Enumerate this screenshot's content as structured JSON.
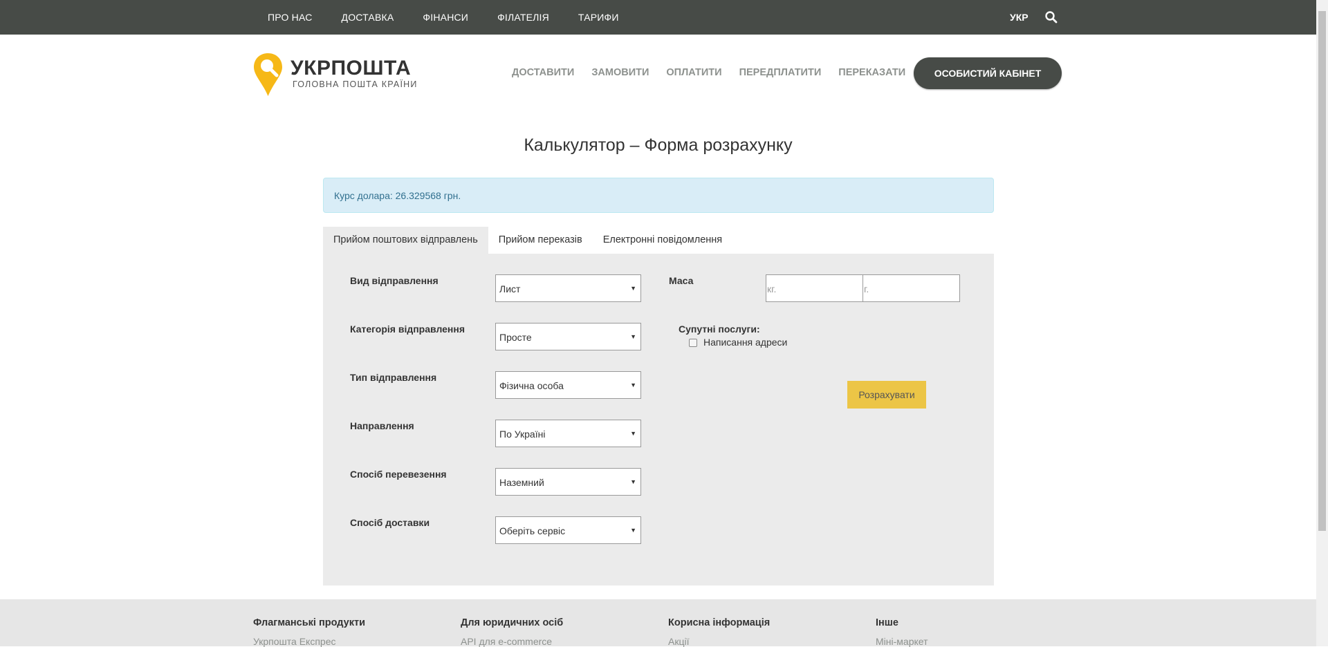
{
  "topbar": {
    "items": [
      "ПРО НАС",
      "ДОСТАВКА",
      "ФІНАНСИ",
      "ФІЛАТЕЛІЯ",
      "ТАРИФИ"
    ],
    "lang": "УКР",
    "search_icon": "search-icon"
  },
  "header": {
    "logo_name": "УКРПОШТА",
    "logo_tagline": "ГОЛОВНА ПОШТА КРАЇНИ",
    "nav": [
      "ДОСТАВИТИ",
      "ЗАМОВИТИ",
      "ОПЛАТИТИ",
      "ПЕРЕДПЛАТИТИ",
      "ПЕРЕКАЗАТИ"
    ],
    "cabinet_button": "ОСОБИСТИЙ КАБІНЕТ"
  },
  "page": {
    "title": "Калькулятор – Форма розрахунку",
    "alert": "Курс долара: 26.329568 грн."
  },
  "tabs": [
    {
      "label": "Прийом поштових відправлень",
      "active": true
    },
    {
      "label": "Прийом переказів",
      "active": false
    },
    {
      "label": "Електронні повідомлення",
      "active": false
    }
  ],
  "form": {
    "fields": [
      {
        "label": "Вид відправлення",
        "value": "Лист"
      },
      {
        "label": "Категорія відправлення",
        "value": "Просте"
      },
      {
        "label": "Тип відправлення",
        "value": "Фізична особа"
      },
      {
        "label": "Направлення",
        "value": "По Україні"
      },
      {
        "label": "Спосіб перевезення",
        "value": "Наземний"
      },
      {
        "label": "Спосіб доставки",
        "value": "Оберіть сервіс"
      }
    ],
    "mass_label": "Маса",
    "kg_placeholder": "кг.",
    "g_placeholder": "г.",
    "services_label": "Супутні послуги:",
    "service_option": "Написання адреси",
    "calculate_button": "Розрахувати"
  },
  "footer": {
    "columns": [
      {
        "title": "Флагманські продукти",
        "link": "Укрпошта Експрес"
      },
      {
        "title": "Для юридичних осіб",
        "link": "API для e-commerce"
      },
      {
        "title": "Корисна інформація",
        "link": "Акції"
      },
      {
        "title": "Інше",
        "link": "Міні-маркет"
      }
    ]
  },
  "colors": {
    "topbar": "#474b47",
    "accent_yellow": "#ecc546",
    "logo_yellow": "#f6b817",
    "alert_bg": "#d9edf7",
    "panel_bg": "#ebebeb"
  }
}
